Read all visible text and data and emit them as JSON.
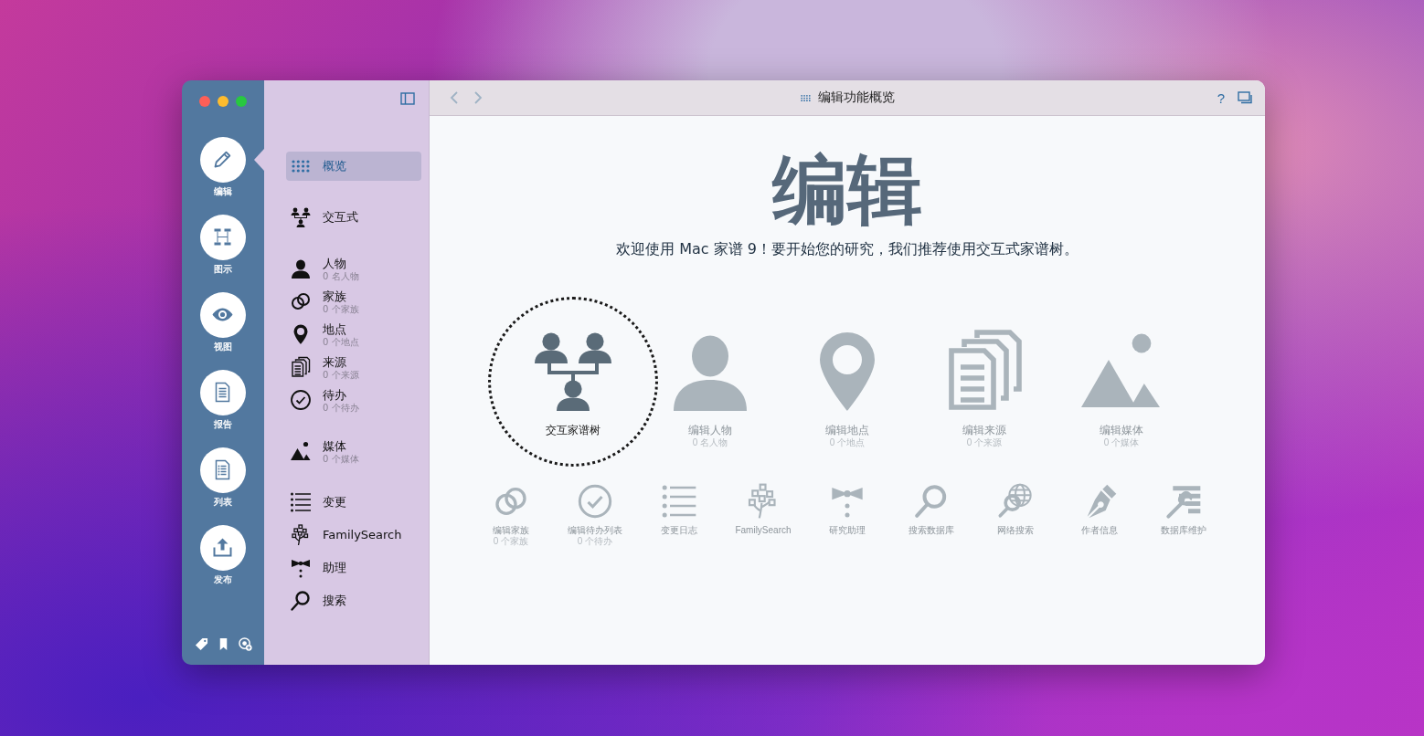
{
  "toolbar": {
    "title": "编辑功能概览",
    "help": "?"
  },
  "rail": {
    "items": [
      {
        "label": "编辑",
        "selected": true
      },
      {
        "label": "图示",
        "selected": false
      },
      {
        "label": "视图",
        "selected": false
      },
      {
        "label": "报告",
        "selected": false
      },
      {
        "label": "列表",
        "selected": false
      },
      {
        "label": "发布",
        "selected": false
      }
    ]
  },
  "sidebar": {
    "groups": [
      [
        {
          "label": "概览",
          "selected": true
        }
      ],
      [
        {
          "label": "交互式",
          "selected": false
        }
      ],
      [
        {
          "label": "人物",
          "count": "0 名人物",
          "selected": false
        },
        {
          "label": "家族",
          "count": "0 个家族",
          "selected": false
        },
        {
          "label": "地点",
          "count": "0 个地点",
          "selected": false
        },
        {
          "label": "来源",
          "count": "0 个来源",
          "selected": false
        },
        {
          "label": "待办",
          "count": "0 个待办",
          "selected": false
        }
      ],
      [
        {
          "label": "媒体",
          "count": "0 个媒体",
          "selected": false
        }
      ],
      [
        {
          "label": "变更",
          "selected": false
        },
        {
          "label": "FamilySearch",
          "selected": false
        },
        {
          "label": "助理",
          "selected": false
        },
        {
          "label": "搜索",
          "selected": false
        }
      ]
    ]
  },
  "content": {
    "heading": "编辑",
    "welcome": "欢迎使用 Mac 家谱 9！要开始您的研究，我们推荐使用交互式家谱树。",
    "features": [
      {
        "label": "交互家谱树",
        "selected": true
      },
      {
        "label": "编辑人物",
        "count": "0 名人物",
        "selected": false
      },
      {
        "label": "编辑地点",
        "count": "0 个地点",
        "selected": false
      },
      {
        "label": "编辑来源",
        "count": "0 个来源",
        "selected": false
      },
      {
        "label": "编辑媒体",
        "count": "0 个媒体",
        "selected": false
      }
    ],
    "tools": [
      {
        "label": "编辑家族",
        "count": "0 个家族"
      },
      {
        "label": "编辑待办列表",
        "count": "0 个待办"
      },
      {
        "label": "变更日志"
      },
      {
        "label": "FamilySearch"
      },
      {
        "label": "研究助理"
      },
      {
        "label": "搜索数据库"
      },
      {
        "label": "网络搜索"
      },
      {
        "label": "作者信息"
      },
      {
        "label": "数据库维护"
      }
    ]
  }
}
